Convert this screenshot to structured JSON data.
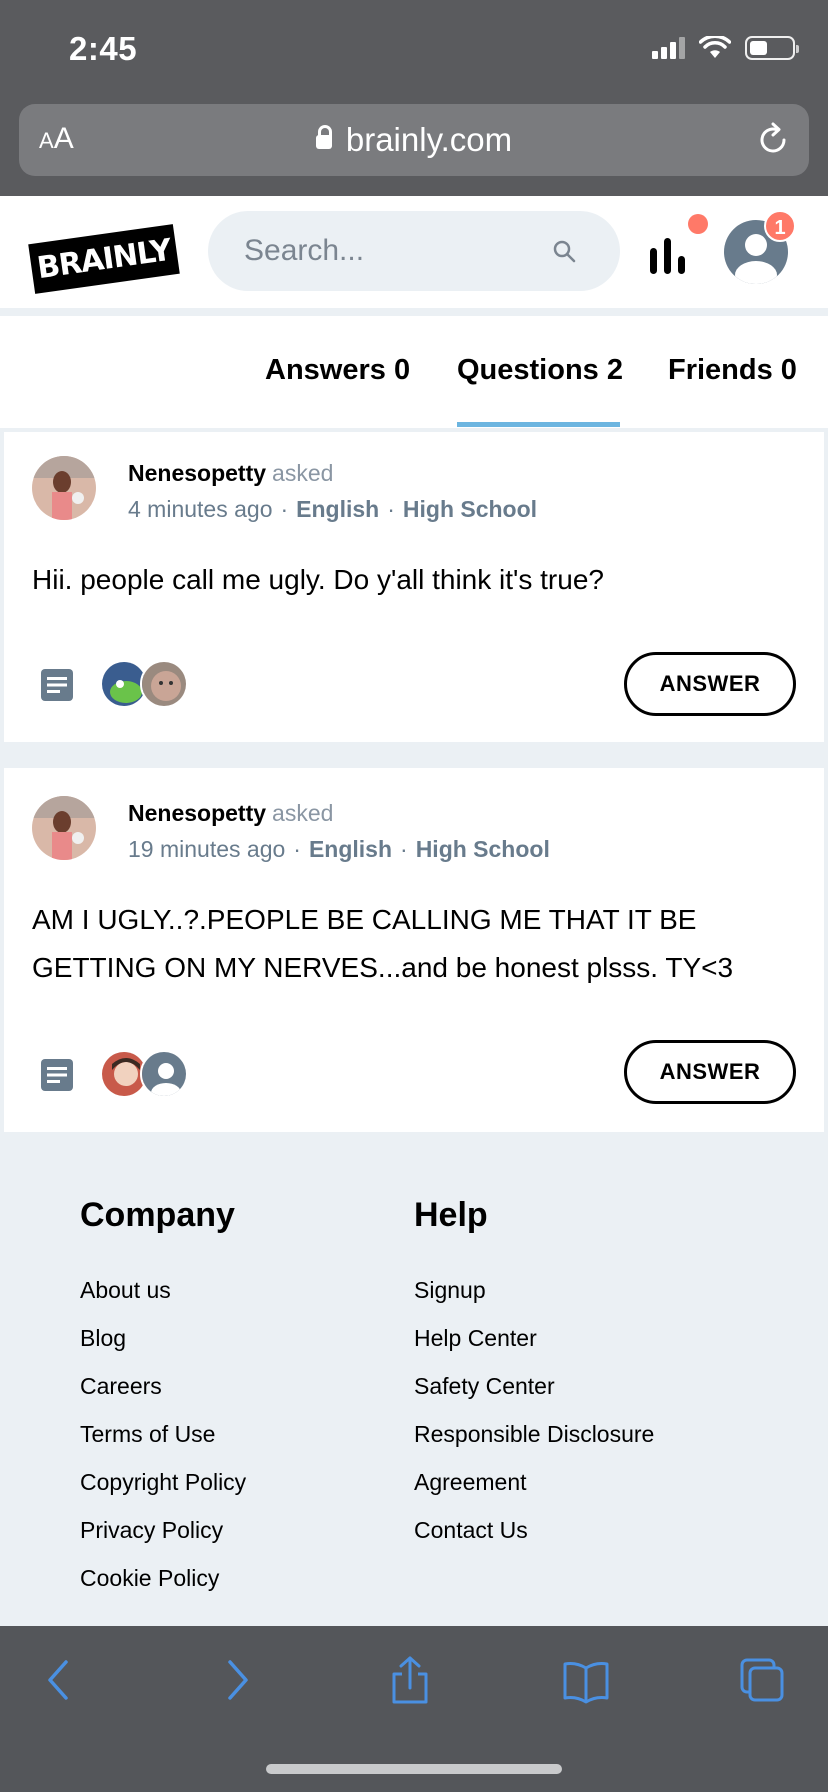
{
  "status_bar": {
    "time": "2:45"
  },
  "url_bar": {
    "text_size": "AA",
    "url": "brainly.com"
  },
  "header": {
    "logo": "BRAINLY",
    "search_placeholder": "Search...",
    "notification_count": "1"
  },
  "tabs": [
    {
      "label": "Answers 0"
    },
    {
      "label": "Questions 2",
      "active": true
    },
    {
      "label": "Friends 0"
    }
  ],
  "questions": [
    {
      "author": "Nenesopetty",
      "action": "asked",
      "time": "4 minutes ago",
      "subject": "English",
      "level": "High School",
      "text": "Hii. people call me ugly. Do y'all think it's true?",
      "answer_label": "ANSWER"
    },
    {
      "author": "Nenesopetty",
      "action": "asked",
      "time": "19 minutes ago",
      "subject": "English",
      "level": "High School",
      "text": "AM I UGLY..?.PEOPLE BE CALLING ME THAT IT BE GETTING ON MY NERVES...and be honest plsss. TY<3",
      "answer_label": "ANSWER"
    }
  ],
  "footer": {
    "company": {
      "title": "Company",
      "links": [
        "About us",
        "Blog",
        "Careers",
        "Terms of Use",
        "Copyright Policy",
        "Privacy Policy",
        "Cookie Policy"
      ]
    },
    "help": {
      "title": "Help",
      "links": [
        "Signup",
        "Help Center",
        "Safety Center",
        "Responsible Disclosure",
        "Agreement",
        "Contact Us"
      ]
    }
  },
  "colors": {
    "accent_tab": "#6cb5e0",
    "badge": "#ff7968",
    "meta_gray": "#687b8c",
    "page_bg": "#ebf0f4",
    "ios_bar": "#5a5b5e",
    "safari_icon": "#4a90e2"
  },
  "icons": {
    "url_bar": [
      "lock-icon",
      "reload-icon"
    ],
    "header": [
      "search-icon",
      "stats-icon",
      "user-avatar"
    ],
    "question": [
      "document-icon"
    ],
    "toolbar": [
      "back-icon",
      "forward-icon",
      "share-icon",
      "bookmarks-icon",
      "tabs-icon"
    ]
  }
}
